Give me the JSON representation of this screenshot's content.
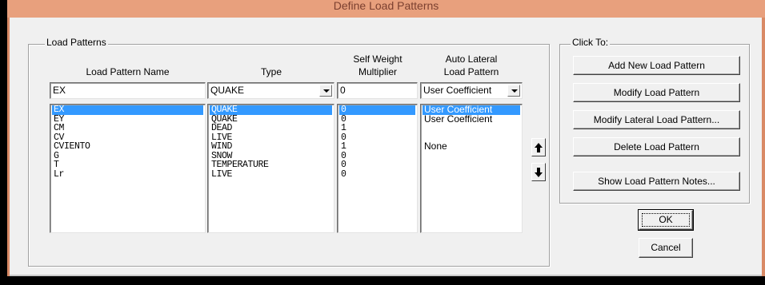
{
  "window": {
    "title": "Define Load Patterns"
  },
  "load_patterns": {
    "group_label": "Load Patterns",
    "headers": {
      "name": "Load Pattern Name",
      "type": "Type",
      "self_weight_l1": "Self Weight",
      "self_weight_l2": "Multiplier",
      "auto_lateral_l1": "Auto Lateral",
      "auto_lateral_l2": "Load Pattern"
    },
    "edit_row": {
      "name": "EX",
      "type": "QUAKE",
      "multiplier": "0",
      "auto_lateral": "User Coefficient"
    },
    "names": [
      "EX",
      "EY",
      "CM",
      "CV",
      "CVIENTO",
      "G",
      "T",
      "Lr"
    ],
    "types": [
      "QUAKE",
      "QUAKE",
      "DEAD",
      "LIVE",
      "WIND",
      "SNOW",
      "TEMPERATURE",
      "LIVE"
    ],
    "multipliers": [
      "0",
      "0",
      "1",
      "0",
      "1",
      "0",
      "0",
      "0"
    ],
    "auto_lateral": [
      "User Coefficient",
      "User Coefficient",
      "",
      "",
      "None",
      "",
      "",
      ""
    ],
    "selected_index": 0
  },
  "click_to": {
    "group_label": "Click To:",
    "add_new": "Add New Load Pattern",
    "modify": "Modify Load Pattern",
    "modify_lateral": "Modify Lateral Load Pattern...",
    "delete": "Delete Load Pattern",
    "show_notes": "Show Load Pattern Notes..."
  },
  "buttons": {
    "ok": "OK",
    "cancel": "Cancel"
  },
  "icons": {
    "move_up": "arrow-up-icon",
    "move_down": "arrow-down-icon"
  }
}
